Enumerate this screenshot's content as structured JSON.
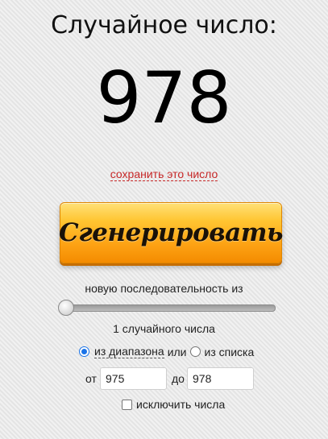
{
  "header": {
    "title": "Случайное число:"
  },
  "result": {
    "value": "978",
    "save_link": "сохранить это число"
  },
  "generate_button": {
    "label": "Сгенерировать"
  },
  "sequence": {
    "label": "новую последовательность из",
    "slider_value": 1,
    "count_label": "1 случайного числа"
  },
  "mode": {
    "selected": "range",
    "range_label": "из диапазона",
    "or_label": "или",
    "list_label": "из списка"
  },
  "range": {
    "from_label": "от",
    "from_value": "975",
    "to_label": "до",
    "to_value": "978"
  },
  "exclude": {
    "label": "исключить числа",
    "checked": false
  },
  "colors": {
    "accent": "#c62828",
    "button": "#fda214",
    "radio": "#1a73e8"
  }
}
